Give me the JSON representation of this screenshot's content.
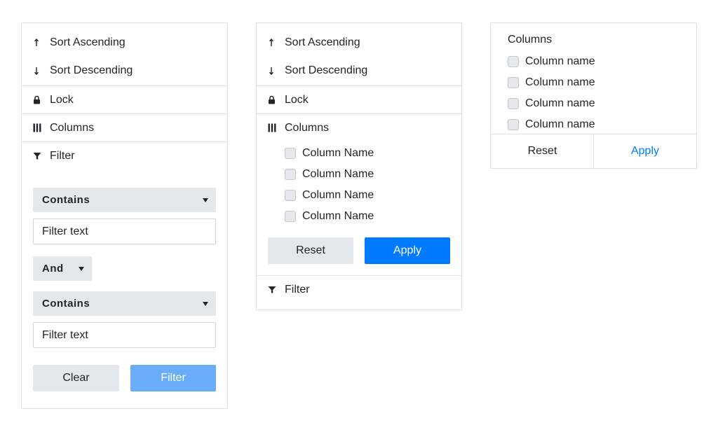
{
  "menus": {
    "sort_ascending": "Sort Ascending",
    "sort_descending": "Sort Descending",
    "lock": "Lock",
    "columns": "Columns",
    "filter": "Filter"
  },
  "filter_panel": {
    "operator1": "Contains",
    "text1_placeholder": "Filter text",
    "logic": "And",
    "operator2": "Contains",
    "text2_placeholder": "Filter text",
    "clear_label": "Clear",
    "filter_label": "Filter"
  },
  "columns_panel": {
    "items": [
      "Column Name",
      "Column Name",
      "Column Name",
      "Column Name"
    ],
    "reset_label": "Reset",
    "apply_label": "Apply"
  },
  "column_chooser": {
    "title": "Columns",
    "items": [
      "Column name",
      "Column name",
      "Column name",
      "Column name"
    ],
    "reset_label": "Reset",
    "apply_label": "Apply"
  },
  "colors": {
    "primary": "#007bff",
    "primary_disabled": "#6aacf5",
    "secondary_bg": "#e4e7eb",
    "border": "#dee2e6"
  }
}
